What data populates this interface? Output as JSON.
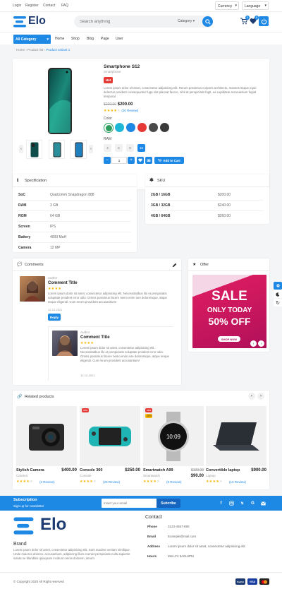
{
  "topbar": {
    "links": [
      "Login",
      "Register",
      "Contact",
      "FAQ"
    ],
    "currency": "Currency",
    "language": "Language"
  },
  "header": {
    "logo_text": "Elo",
    "search_placeholder": "Search anything",
    "category_label": "Category",
    "cart_count": "0",
    "wishlist_count": "0"
  },
  "nav": {
    "all_category": "All Category",
    "items": [
      "Home",
      "Shop",
      "Blog",
      "Page",
      "User"
    ]
  },
  "breadcrumb": [
    "Home",
    "Product list",
    "Product variant 1"
  ],
  "product": {
    "title": "Smartphone S12",
    "brand": "Smartphone",
    "badge": "Hot",
    "description": "Lorem ipsum dolor sit amet, consectetur adipisicing elit. Rerum possimus corporis architecto, maiores itaque eque delectus proident consequuntur fuga sint placeat facere, nihil at perspiciatis fugit, ea cupiditate accusantium fugiat temporal",
    "old_price": "$220.00",
    "price": "$200.00",
    "review_text": "(10 Review)",
    "color_label": "Color",
    "colors": [
      "#2e9e5e",
      "#1fb7d6",
      "#1e88e5",
      "#e53935",
      "#4a4a4a",
      "#3a3a3a"
    ],
    "ram_label": "RAM",
    "ram_options": [
      "4",
      "6",
      "8",
      "16"
    ],
    "quantity": "1",
    "add_to_cart": "Add to Cart"
  },
  "specification": {
    "title": "Specification",
    "rows": [
      {
        "key": "SoC",
        "value": "Qualcomm Snapdragon 888"
      },
      {
        "key": "RAM",
        "value": "3 GB"
      },
      {
        "key": "ROM",
        "value": "64 GB"
      },
      {
        "key": "Screen",
        "value": "IPS"
      },
      {
        "key": "Battery",
        "value": "4000 MaH"
      },
      {
        "key": "Camera",
        "value": "12 MP"
      }
    ]
  },
  "sku": {
    "title": "SKU",
    "rows": [
      {
        "key": "2GB / 16GB",
        "value": "$200.00"
      },
      {
        "key": "3GB / 32GB",
        "value": "$240.00"
      },
      {
        "key": "4GB / 64GB",
        "value": "$260.00"
      }
    ]
  },
  "comments": {
    "title": "Comments",
    "items": [
      {
        "author_label": "Author",
        "title": "Comment Title",
        "text": "Lorem ipsum dolor sit amet, consectetur adipisicing elit. Necessitatibus illo et perspiciatis voluptate proident error odio. Omnis possimus facere nemo enim iure doloremque, atque neque eligendi. Cum rerum provident accusantium!",
        "date": "12-12-2021",
        "reply": "Reply"
      },
      {
        "author_label": "Author",
        "title": "Comment Title",
        "text": "Lorem ipsum dolor sit amet, consectetur adipisicing elit. Necessitatibus illo et perspiciatis voluptate proident error odio. Omnis possimus facere nemo enim iure doloremque, atque neque eligendi. Cum rerum provident accusantium!",
        "date": "12-12-2021"
      }
    ]
  },
  "offer": {
    "title": "Offer",
    "sale": "SALE",
    "only_today": "ONLY TODAY",
    "discount": "50% OFF",
    "shop_now": "SHOP NOW"
  },
  "related": {
    "title": "Related products",
    "items": [
      {
        "name": "Stylish Camera",
        "price": "$400.00",
        "old_price": "",
        "category": "Camera",
        "reviews": "(2 Review)",
        "badge": ""
      },
      {
        "name": "Console 360",
        "price": "$250.00",
        "old_price": "",
        "category": "Console",
        "reviews": "(20 Review)",
        "badge": "new"
      },
      {
        "name": "Smartwatch A99",
        "price": "$90.00",
        "old_price": "$100.00",
        "category": "Smartwatch",
        "reviews": "(8 Review)",
        "badge": "new",
        "badge2": "-15%"
      },
      {
        "name": "Convertible laptop",
        "price": "$900.00",
        "old_price": "",
        "category": "Laptop",
        "reviews": "(10 Review)",
        "badge": ""
      }
    ]
  },
  "subscription": {
    "title": "Subscription",
    "subtitle": "Sign up for newsletter",
    "placeholder": "Insert your email",
    "button": "Subcribe"
  },
  "footer": {
    "brand_heading": "Brand",
    "brand_text": "Lorem ipsum dolor sit amet, consectetur adipisicing elit. Sunt maxime veniam similique. Unde maiores dolores, accusantium, adipiscing illum eveniet perspiciatis nulla sapiente soluta ne blanditiis quisquam incidunt omnis dolorem, iterum.",
    "contact_heading": "Contact",
    "contact": [
      {
        "label": "Phone",
        "value": "0123-4567-890"
      },
      {
        "label": "Email",
        "value": "Example@mail.com"
      },
      {
        "label": "Address",
        "value": "Lorem ipsum dolor sit amet, consectetur adipisicing elit."
      },
      {
        "label": "Hours",
        "value": "Mon-Fri 9AM-6PM"
      }
    ],
    "copyright": "© Copyright 2020 All Right reserved",
    "payments": [
      "PayPal",
      "VISA",
      ""
    ]
  }
}
